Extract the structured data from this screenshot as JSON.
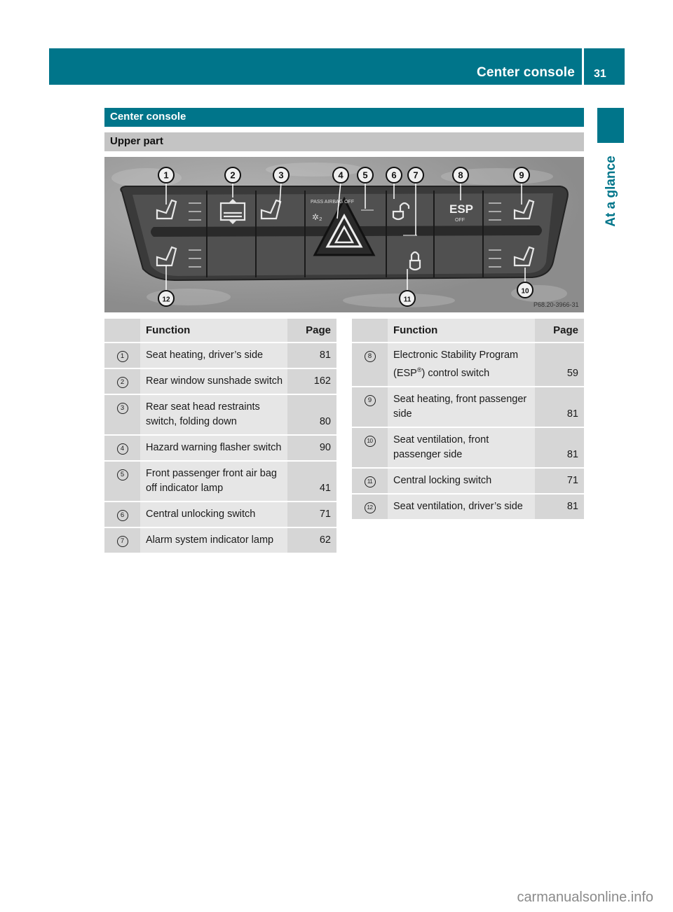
{
  "header": {
    "running_title": "Center console",
    "page_number": "31",
    "side_tab_label": "At a glance"
  },
  "section": {
    "title": "Center console",
    "subtitle": "Upper part"
  },
  "figure": {
    "reference_code": "P68.20-3966-31",
    "panel_labels": {
      "passenger_airbag": "PASS  AIRBAG  OFF",
      "esp": "ESP",
      "esp_off": "OFF"
    },
    "callouts": [
      "1",
      "2",
      "3",
      "4",
      "5",
      "6",
      "7",
      "8",
      "9",
      "10",
      "11",
      "12"
    ]
  },
  "table_left": {
    "headers": {
      "num": "",
      "function": "Function",
      "page": "Page"
    },
    "rows": [
      {
        "num": "1",
        "function": "Seat heating, driver’s side",
        "page": "81"
      },
      {
        "num": "2",
        "function": "Rear window sunshade switch",
        "page": "162"
      },
      {
        "num": "3",
        "function": "Rear seat head restraints switch, folding down",
        "page": "80"
      },
      {
        "num": "4",
        "function": "Hazard warning flasher switch",
        "page": "90"
      },
      {
        "num": "5",
        "function": "Front passenger front air bag off indicator lamp",
        "page": "41"
      },
      {
        "num": "6",
        "function": "Central unlocking switch",
        "page": "71"
      },
      {
        "num": "7",
        "function": "Alarm system indicator lamp",
        "page": "62"
      }
    ]
  },
  "table_right": {
    "headers": {
      "num": "",
      "function": "Function",
      "page": "Page"
    },
    "rows": [
      {
        "num": "8",
        "function_pre": "Electronic Stability Program (ESP",
        "function_sup": "®",
        "function_post": ") control switch",
        "page": "59"
      },
      {
        "num": "9",
        "function": "Seat heating, front passenger side",
        "page": "81"
      },
      {
        "num": "10",
        "function": "Seat ventilation, front passenger side",
        "page": "81"
      },
      {
        "num": "11",
        "function": "Central locking switch",
        "page": "71"
      },
      {
        "num": "12",
        "function": "Seat ventilation, driver’s side",
        "page": "81"
      }
    ]
  },
  "footer": {
    "watermark": "carmanualsonline.info"
  }
}
